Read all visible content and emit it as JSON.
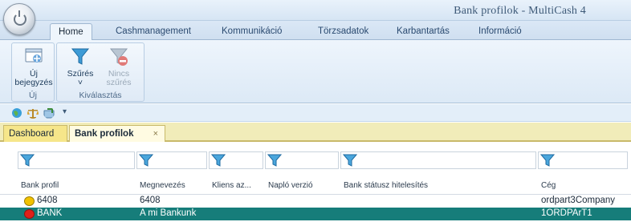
{
  "window": {
    "title": "Bank profilok - MultiCash 4"
  },
  "ribbon_tabs": [
    "Home",
    "Cashmanagement",
    "Kommunikáció",
    "Törzsadatok",
    "Karbantartás",
    "Információ"
  ],
  "ribbon": {
    "groups": [
      {
        "label": "Új",
        "buttons": [
          {
            "label_line1": "Új",
            "label_line2": "bejegyzés",
            "icon": "new-entry-icon",
            "enabled": true
          }
        ]
      },
      {
        "label": "Kiválasztás",
        "buttons": [
          {
            "label_line1": "Szűrés",
            "label_line2": "˅",
            "icon": "filter-icon",
            "enabled": true
          },
          {
            "label_line1": "Nincs",
            "label_line2": "szűrés",
            "icon": "no-filter-icon",
            "enabled": false
          }
        ]
      }
    ]
  },
  "quick_access": {
    "icons": [
      "globe-icon",
      "scales-icon",
      "export-icon",
      "dropdown-arrow-icon"
    ],
    "more": "▾"
  },
  "document_tabs": [
    {
      "label": "Dashboard",
      "active": false
    },
    {
      "label": "Bank profilok",
      "active": true,
      "close": "×"
    }
  ],
  "grid": {
    "columns": [
      "Bank profil",
      "Megnevezés",
      "Kliens az...",
      "Napló verzió",
      "Bank státusz hitelesítés",
      "Cég"
    ],
    "rows": [
      {
        "status_color": "#f2c200",
        "bank_profil": "6408",
        "megnevezes": "6408",
        "kliens": "",
        "naplo": "",
        "statusz": "",
        "ceg": "ordpart3Company",
        "selected": false
      },
      {
        "status_color": "#e0201a",
        "bank_profil": "BANK",
        "megnevezes": "A mi Bankunk",
        "kliens": "",
        "naplo": "",
        "statusz": "",
        "ceg": "1ORDPArT1",
        "selected": true
      }
    ]
  },
  "colors": {
    "accent_teal": "#167d7a",
    "doc_tab_bar": "#f1ecb9"
  }
}
